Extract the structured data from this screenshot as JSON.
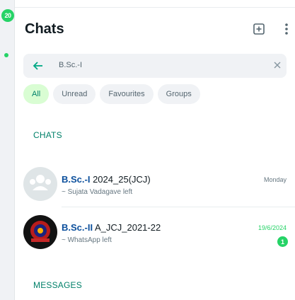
{
  "rail": {
    "badge": "20"
  },
  "header": {
    "title": "Chats"
  },
  "search": {
    "query": "B.Sc.-I"
  },
  "filters": [
    "All",
    "Unread",
    "Favourites",
    "Groups"
  ],
  "sections": {
    "chats": "CHATS",
    "messages": "MESSAGES"
  },
  "chats": [
    {
      "name_bold": "B.Sc.-I",
      "name_rest": " 2024_25(JCJ)",
      "subtitle": "~ Sujata Vadagave left",
      "time": "Monday",
      "unread": ""
    },
    {
      "name_bold": "B.Sc.-II",
      "name_rest": " A_JCJ_2021-22",
      "subtitle": "~ WhatsApp left",
      "time": "19/6/2024",
      "unread": "1"
    }
  ],
  "colors": {
    "accent": "#008069",
    "unread_green": "#25d366",
    "chip_active_bg": "#d9fdd3"
  },
  "icons": [
    "back-arrow-icon",
    "clear-icon",
    "new-chat-icon",
    "menu-icon"
  ]
}
